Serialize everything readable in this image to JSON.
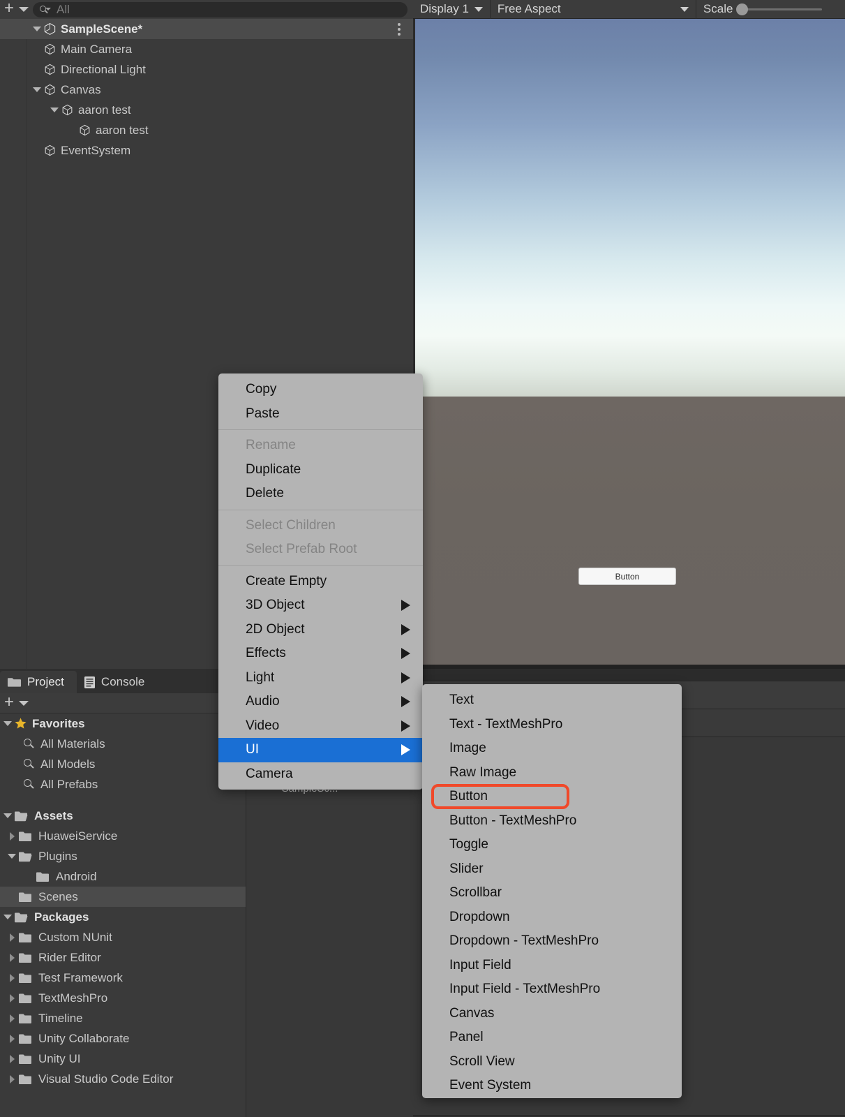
{
  "hierarchy": {
    "toolbar": {
      "add_label": "+",
      "search_placeholder": "All",
      "search_value": ""
    },
    "scene_name": "SampleScene*",
    "items": [
      {
        "label": "Main Camera",
        "depth": 1,
        "twisty": "none",
        "icon": "cube-icon"
      },
      {
        "label": "Directional Light",
        "depth": 1,
        "twisty": "none",
        "icon": "cube-icon"
      },
      {
        "label": "Canvas",
        "depth": 1,
        "twisty": "down",
        "icon": "cube-icon"
      },
      {
        "label": "aaron test",
        "depth": 2,
        "twisty": "down",
        "icon": "cube-icon"
      },
      {
        "label": "aaron test",
        "depth": 3,
        "twisty": "none",
        "icon": "cube-icon"
      },
      {
        "label": "EventSystem",
        "depth": 1,
        "twisty": "none",
        "icon": "cube-icon"
      }
    ]
  },
  "game_view": {
    "display_label": "Display 1",
    "aspect_label": "Free Aspect",
    "scale_label": "Scale",
    "button_label": "Button"
  },
  "project": {
    "tabs": [
      {
        "label": "Project",
        "icon": "folder-icon",
        "active": true
      },
      {
        "label": "Console",
        "icon": "console-icon",
        "active": false
      }
    ],
    "toolbar": {
      "add_label": "+"
    },
    "favorites": {
      "label": "Favorites",
      "items": [
        {
          "label": "All Materials",
          "icon": "search-icon"
        },
        {
          "label": "All Models",
          "icon": "search-icon"
        },
        {
          "label": "All Prefabs",
          "icon": "search-icon"
        }
      ]
    },
    "assets": {
      "label": "Assets",
      "items": [
        {
          "label": "HuaweiService",
          "depth": 1,
          "twisty": "right",
          "selected": false
        },
        {
          "label": "Plugins",
          "depth": 1,
          "twisty": "down",
          "selected": false
        },
        {
          "label": "Android",
          "depth": 2,
          "twisty": "none",
          "selected": false
        },
        {
          "label": "Scenes",
          "depth": 1,
          "twisty": "none",
          "selected": true
        }
      ]
    },
    "packages": {
      "label": "Packages",
      "items": [
        {
          "label": "Custom NUnit",
          "twisty": "right"
        },
        {
          "label": "Rider Editor",
          "twisty": "right"
        },
        {
          "label": "Test Framework",
          "twisty": "right"
        },
        {
          "label": "TextMeshPro",
          "twisty": "right"
        },
        {
          "label": "Timeline",
          "twisty": "right"
        },
        {
          "label": "Unity Collaborate",
          "twisty": "right"
        },
        {
          "label": "Unity UI",
          "twisty": "right"
        },
        {
          "label": "Visual Studio Code Editor",
          "twisty": "right"
        }
      ]
    },
    "asset_item": {
      "label": "SampleSc..."
    }
  },
  "context_menu": {
    "groups": [
      {
        "items": [
          {
            "label": "Copy",
            "disabled": false,
            "submenu": false,
            "highlight": false
          },
          {
            "label": "Paste",
            "disabled": false,
            "submenu": false,
            "highlight": false
          }
        ]
      },
      {
        "items": [
          {
            "label": "Rename",
            "disabled": true,
            "submenu": false,
            "highlight": false
          },
          {
            "label": "Duplicate",
            "disabled": false,
            "submenu": false,
            "highlight": false
          },
          {
            "label": "Delete",
            "disabled": false,
            "submenu": false,
            "highlight": false
          }
        ]
      },
      {
        "items": [
          {
            "label": "Select Children",
            "disabled": true,
            "submenu": false,
            "highlight": false
          },
          {
            "label": "Select Prefab Root",
            "disabled": true,
            "submenu": false,
            "highlight": false
          }
        ]
      },
      {
        "items": [
          {
            "label": "Create Empty",
            "disabled": false,
            "submenu": false,
            "highlight": false
          },
          {
            "label": "3D Object",
            "disabled": false,
            "submenu": true,
            "highlight": false
          },
          {
            "label": "2D Object",
            "disabled": false,
            "submenu": true,
            "highlight": false
          },
          {
            "label": "Effects",
            "disabled": false,
            "submenu": true,
            "highlight": false
          },
          {
            "label": "Light",
            "disabled": false,
            "submenu": true,
            "highlight": false
          },
          {
            "label": "Audio",
            "disabled": false,
            "submenu": true,
            "highlight": false
          },
          {
            "label": "Video",
            "disabled": false,
            "submenu": true,
            "highlight": false
          },
          {
            "label": "UI",
            "disabled": false,
            "submenu": true,
            "highlight": true
          },
          {
            "label": "Camera",
            "disabled": false,
            "submenu": false,
            "highlight": false
          }
        ]
      }
    ]
  },
  "ui_submenu": {
    "items": [
      {
        "label": "Text",
        "annotated": false
      },
      {
        "label": "Text - TextMeshPro",
        "annotated": false
      },
      {
        "label": "Image",
        "annotated": false
      },
      {
        "label": "Raw Image",
        "annotated": false
      },
      {
        "label": "Button",
        "annotated": true
      },
      {
        "label": "Button - TextMeshPro",
        "annotated": false
      },
      {
        "label": "Toggle",
        "annotated": false
      },
      {
        "label": "Slider",
        "annotated": false
      },
      {
        "label": "Scrollbar",
        "annotated": false
      },
      {
        "label": "Dropdown",
        "annotated": false
      },
      {
        "label": "Dropdown - TextMeshPro",
        "annotated": false
      },
      {
        "label": "Input Field",
        "annotated": false
      },
      {
        "label": "Input Field - TextMeshPro",
        "annotated": false
      },
      {
        "label": "Canvas",
        "annotated": false
      },
      {
        "label": "Panel",
        "annotated": false
      },
      {
        "label": "Scroll View",
        "annotated": false
      },
      {
        "label": "Event System",
        "annotated": false
      }
    ]
  },
  "colors": {
    "menu_bg": "#b4b4b4",
    "highlight_blue": "#1a6fd4",
    "annotation_red": "#f0492a",
    "panel_bg": "#3a3a3a",
    "toolbar_bg": "#3c3c3c",
    "row_selected": "#4b4b4b",
    "favorite_star": "#e8b52a"
  }
}
